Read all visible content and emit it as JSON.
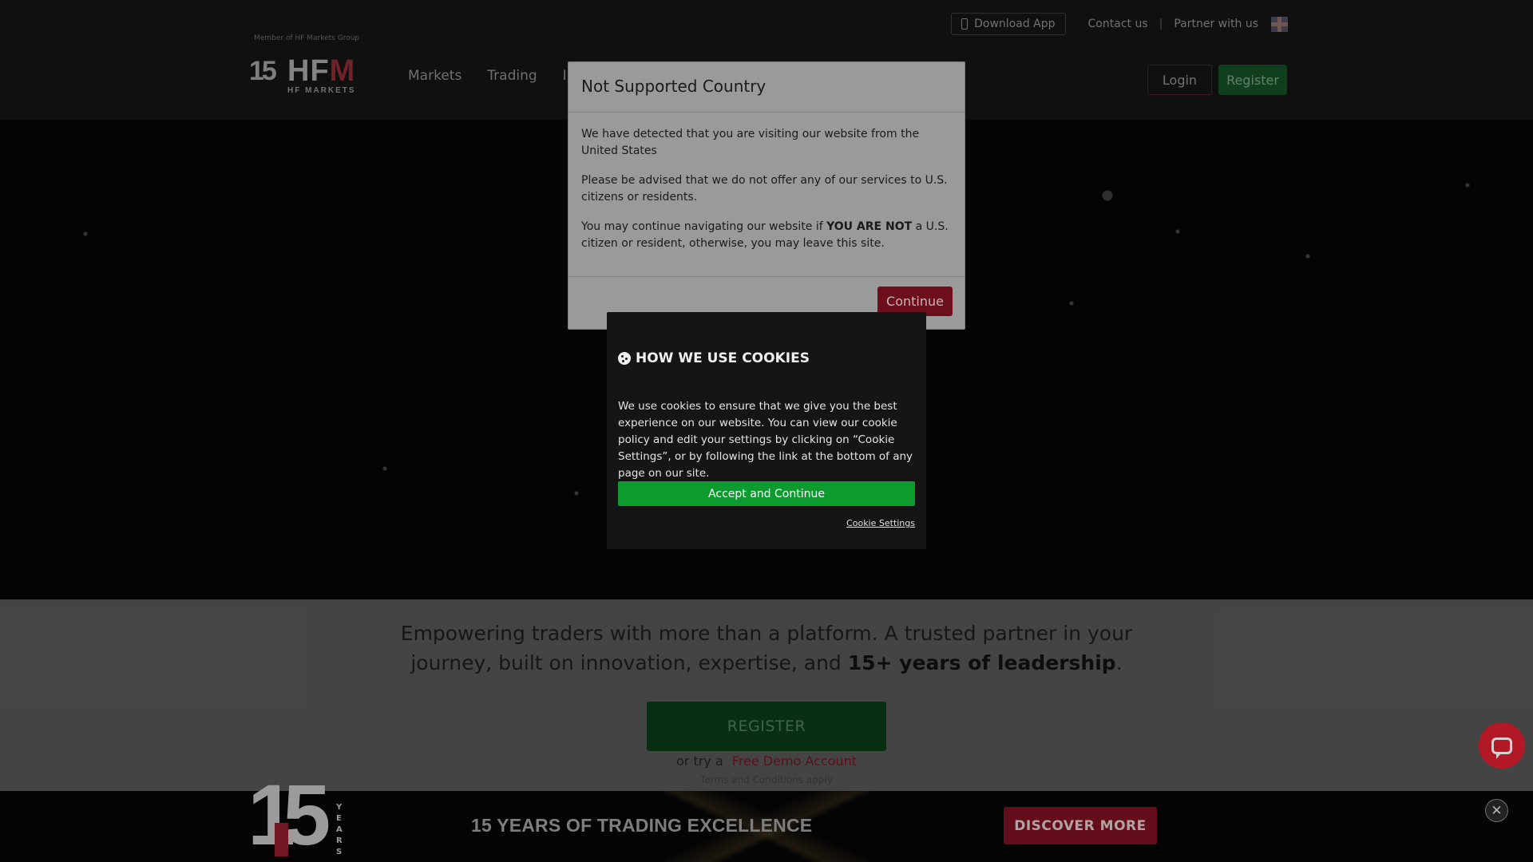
{
  "topbar": {
    "download_label": "Download App",
    "contact_label": "Contact us",
    "separator": "|",
    "partner_label": "Partner with us",
    "flag_icon": "uk-flag-icon"
  },
  "brand": {
    "member_text": "Member of HF Markets Group",
    "logo_15": "15",
    "logo_main": "HF",
    "logo_main_red": "M",
    "logo_sub": "HF MARKETS"
  },
  "nav": {
    "items": [
      "Markets",
      "Trading",
      "Inv"
    ],
    "login_label": "Login",
    "register_label": "Register"
  },
  "country_modal": {
    "title": "Not Supported Country",
    "para1": "We have detected that you are visiting our website from the United States",
    "para2": "Please be advised that we do not offer any of our services to U.S. citizens or residents.",
    "para3_pre": "You may continue navigating our website if ",
    "para3_bold": "YOU ARE NOT",
    "para3_post": " a U.S. citizen or resident, otherwise, you may leave this site.",
    "continue_label": "Continue"
  },
  "cookie_modal": {
    "title": "HOW WE USE COOKIES",
    "text": "We use cookies to ensure that we give you the best experience on our website. You can view our cookie policy and edit your settings by clicking on “Cookie Settings”, or by following the link at the bottom of any page on our site.",
    "accept_label": "Accept and Continue",
    "settings_label": "Cookie Settings"
  },
  "hero_lower": {
    "tagline_pre": "Empowering traders with more than a platform. A trusted partner in your journey, built on innovation, expertise, and ",
    "tagline_bold": "15+ years of leadership",
    "tagline_post": ".",
    "register_label": "REGISTER",
    "demo_prefix": "or try a",
    "demo_link": "Free Demo Account",
    "terms": "Terms and Conditions apply"
  },
  "promo": {
    "big_number": "15",
    "years_letters": [
      "Y",
      "E",
      "A",
      "R",
      "S"
    ],
    "title": "15 YEARS OF TRADING EXCELLENCE",
    "button_label": "DISCOVER MORE",
    "close_symbol": "✕"
  },
  "colors": {
    "accent_red": "#d91e2e",
    "accent_green": "#0d9a2e",
    "modal_continue": "#6d0f1b"
  }
}
